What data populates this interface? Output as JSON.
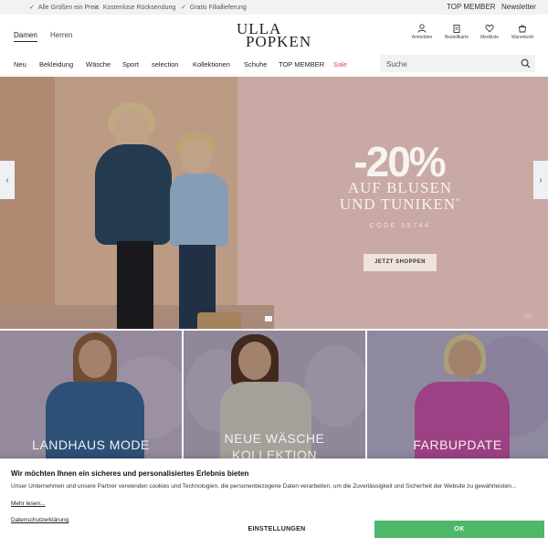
{
  "topbar": {
    "usps": [
      "Alle Größen ein Preis",
      "Kostenlose Rücksendung",
      "Gratis Filiallieferung"
    ],
    "links": [
      "TOP MEMBER",
      "Newsletter"
    ]
  },
  "header": {
    "genders": [
      "Damen",
      "Herren"
    ],
    "logo_line1": "ULLA",
    "logo_line2": "POPKEN",
    "icons": [
      {
        "name": "user-icon",
        "label": "Anmelden"
      },
      {
        "name": "clipboard-icon",
        "label": "Bestellkarte"
      },
      {
        "name": "heart-icon",
        "label": "Merkliste"
      },
      {
        "name": "cart-icon",
        "label": "Warenkorb"
      }
    ]
  },
  "nav": {
    "items": [
      "Neu",
      "Bekleidung",
      "Wäsche",
      "Sport",
      "selection",
      "Kollektionen",
      "Schuhe",
      "TOP MEMBER",
      "Sale"
    ],
    "sale_color": "#e0405a"
  },
  "search": {
    "placeholder": "Suche"
  },
  "hero": {
    "discount": "-20%",
    "line1": "AUF BLUSEN",
    "line2": "UND TUNIKEN",
    "line2_mark": "*",
    "code": "CODE 55744",
    "cta": "JETZT SHOPPEN",
    "prev_arrow": "‹",
    "next_arrow": "›"
  },
  "tiles": [
    {
      "title_line1": "LANDHAUS MODE",
      "title_line2": ""
    },
    {
      "title_line1": "NEUE WÄSCHE",
      "title_line2": "KOLLEKTION"
    },
    {
      "title_line1": "FARBUPDATE",
      "title_line2": ""
    }
  ],
  "cookie": {
    "title": "Wir möchten Ihnen ein sicheres und personalisiertes Erlebnis bieten",
    "body": "Unser Unternehmen und unsere Partner verwenden cookies und Technologien, die personenbezogene Daten verarbeiten, um die Zuverlässigkeit und Sicherheit der Website zu gewährleisten...",
    "more": "Mehr lesen...",
    "privacy": "Datenschutzerklärung",
    "settings_label": "EINSTELLUNGEN",
    "ok_label": "OK",
    "ok_color": "#4db86a"
  }
}
